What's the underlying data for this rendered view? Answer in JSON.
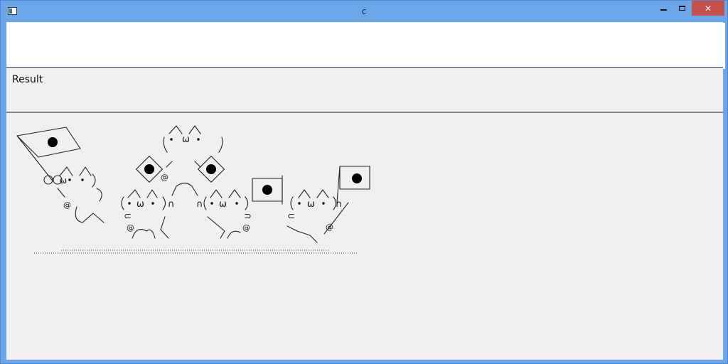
{
  "window": {
    "title": "c"
  },
  "input": {
    "value": ""
  },
  "result": {
    "label": "Result"
  },
  "art": {
    "description_words": [
      "ω",
      "@",
      "∩",
      "⊂",
      "⊃"
    ]
  },
  "colors": {
    "titlebar": "#6aa7ea",
    "close_button": "#c7504a",
    "panel": "#f0f0f0"
  },
  "icons": [
    "app-icon",
    "minimize-icon",
    "maximize-icon",
    "close-icon"
  ]
}
